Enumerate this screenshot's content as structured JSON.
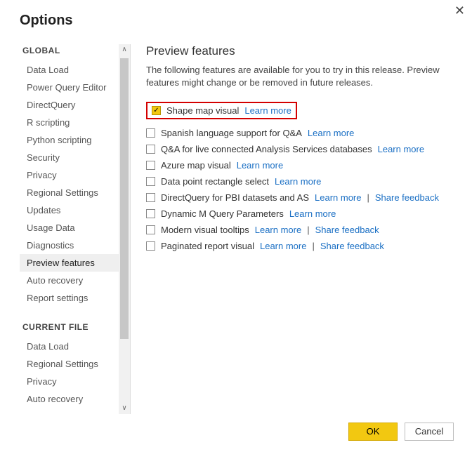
{
  "dialog": {
    "title": "Options",
    "close_glyph": "✕"
  },
  "sidebar": {
    "section_global": "GLOBAL",
    "global_items": [
      "Data Load",
      "Power Query Editor",
      "DirectQuery",
      "R scripting",
      "Python scripting",
      "Security",
      "Privacy",
      "Regional Settings",
      "Updates",
      "Usage Data",
      "Diagnostics",
      "Preview features",
      "Auto recovery",
      "Report settings"
    ],
    "global_selected_index": 11,
    "section_current": "CURRENT FILE",
    "current_items": [
      "Data Load",
      "Regional Settings",
      "Privacy",
      "Auto recovery"
    ]
  },
  "main": {
    "heading": "Preview features",
    "intro": "The following features are available for you to try in this release. Preview features might change or be removed in future releases.",
    "learn_more": "Learn more",
    "share_feedback": "Share feedback",
    "sep": "|",
    "features": [
      {
        "label": "Shape map visual",
        "checked": true,
        "learn": true,
        "feedback": false,
        "highlight": true
      },
      {
        "label": "Spanish language support for Q&A",
        "checked": false,
        "learn": true,
        "feedback": false
      },
      {
        "label": "Q&A for live connected Analysis Services databases",
        "checked": false,
        "learn": true,
        "feedback": false
      },
      {
        "label": "Azure map visual",
        "checked": false,
        "learn": true,
        "feedback": false
      },
      {
        "label": "Data point rectangle select",
        "checked": false,
        "learn": true,
        "feedback": false
      },
      {
        "label": "DirectQuery for PBI datasets and AS",
        "checked": false,
        "learn": true,
        "feedback": true
      },
      {
        "label": "Dynamic M Query Parameters",
        "checked": false,
        "learn": true,
        "feedback": false
      },
      {
        "label": "Modern visual tooltips",
        "checked": false,
        "learn": true,
        "feedback": true
      },
      {
        "label": "Paginated report visual",
        "checked": false,
        "learn": true,
        "feedback": true
      }
    ]
  },
  "footer": {
    "ok": "OK",
    "cancel": "Cancel"
  }
}
